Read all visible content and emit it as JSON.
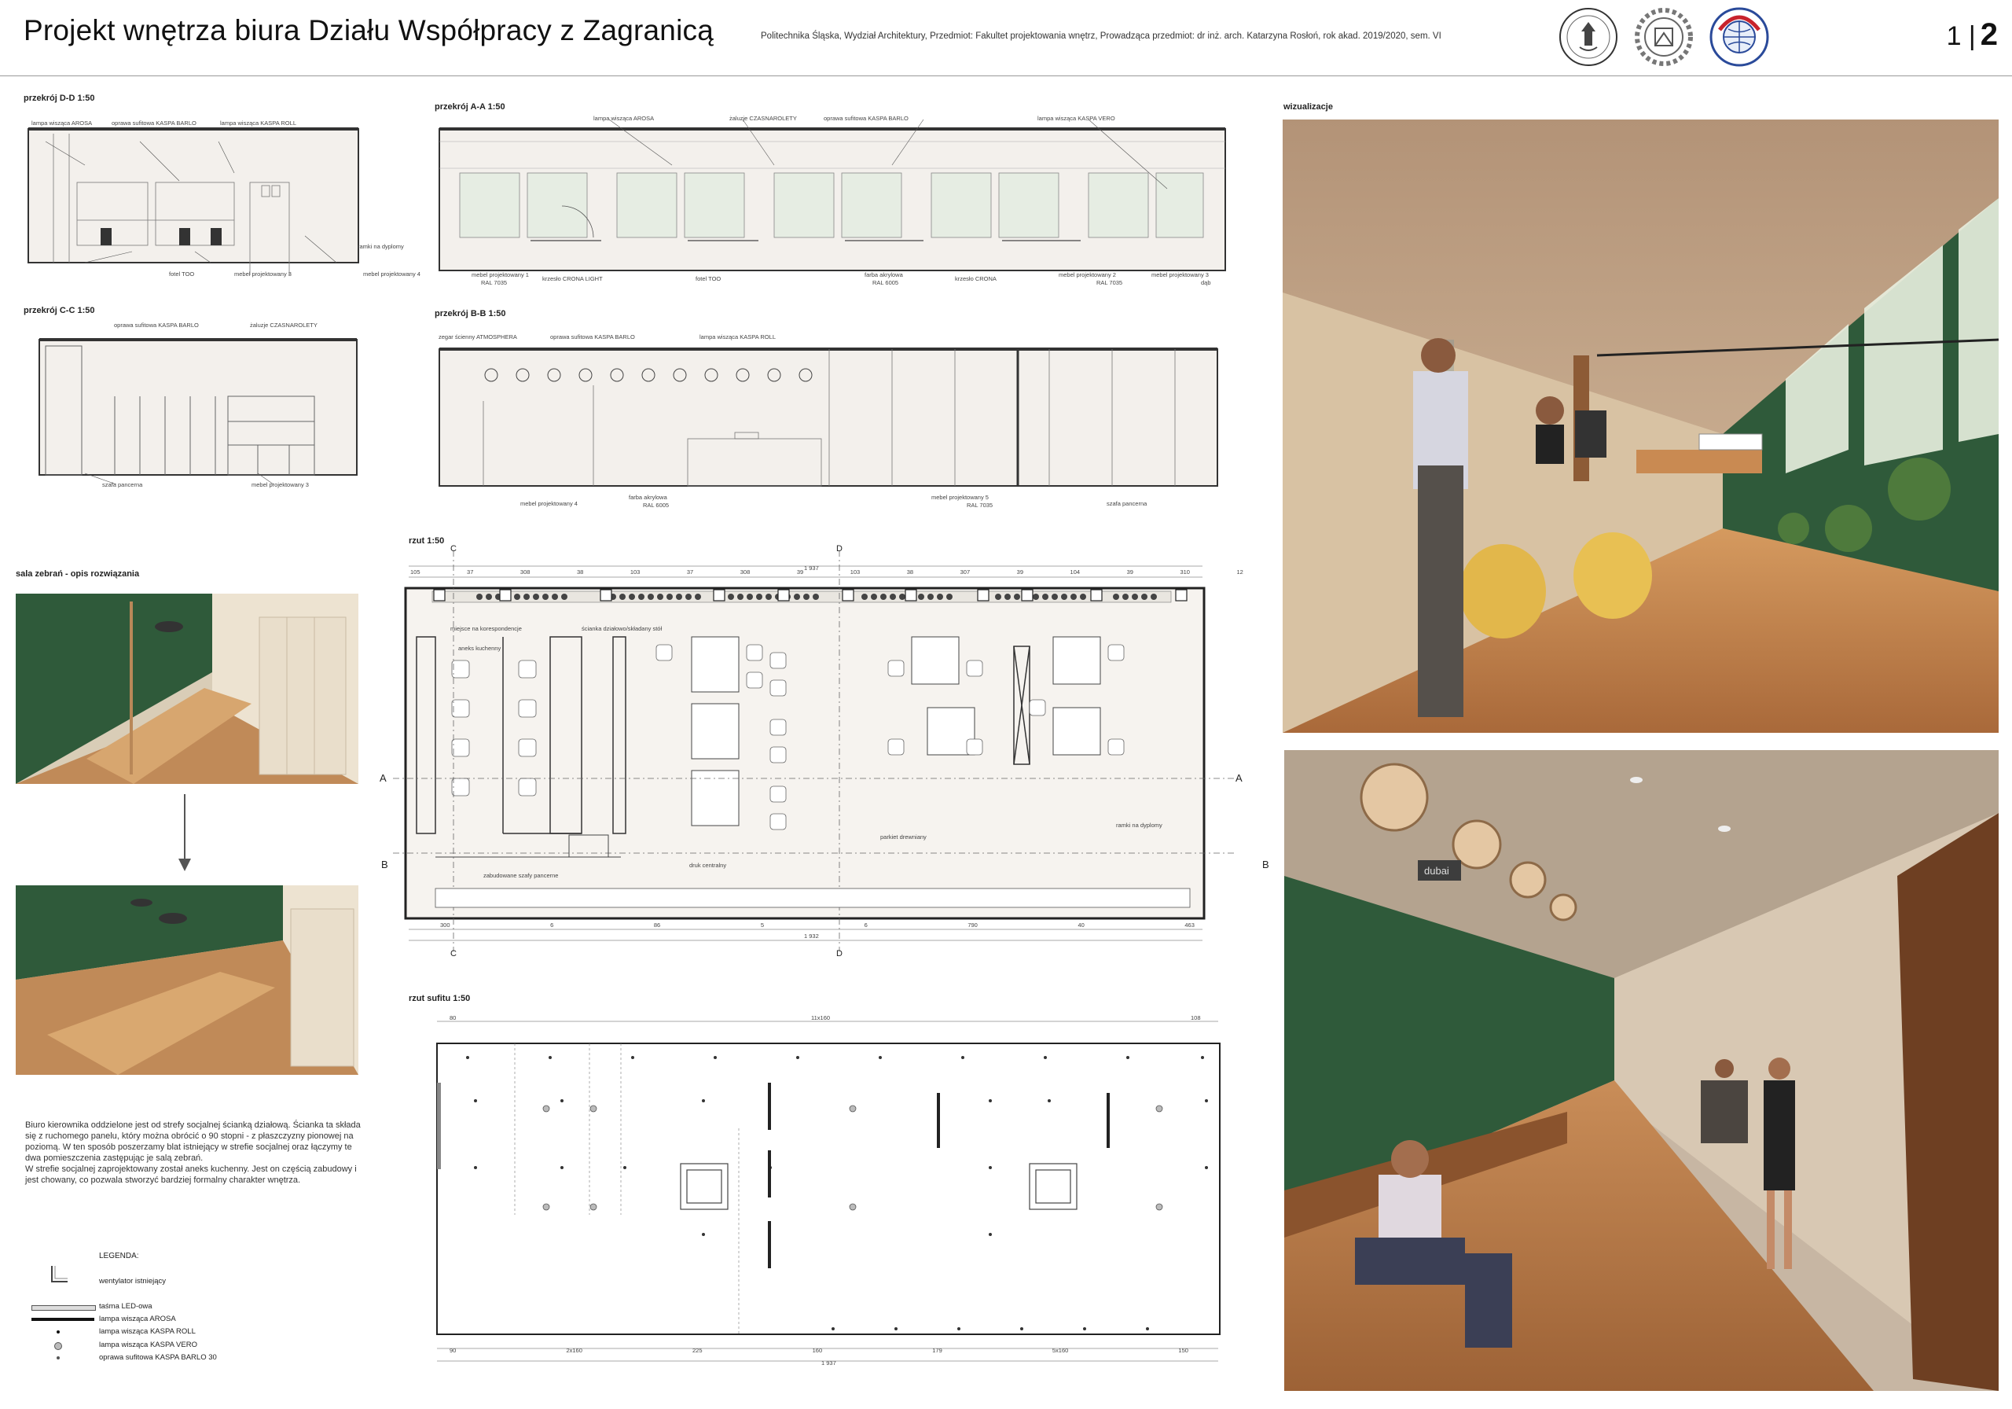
{
  "header": {
    "title": "Projekt wnętrza biura Działu Współpracy z Zagranicą",
    "info": "Politechnika Śląska, Wydział Architektury, Przedmiot: Fakultet projektowania wnętrz, Prowadząca przedmiot: dr inż. arch. Katarzyna Rosłoń, rok akad. 2019/2020, sem. VI",
    "page_prefix": "1 |",
    "page_number": "2",
    "logo3_text": "INTERNATIONAL MOBILITY OFFICE SILESIAN UNIVERSITY OF TECHNOLOGY"
  },
  "sections": {
    "dd": "przekrój D-D 1:50",
    "cc": "przekrój C-C 1:50",
    "aa": "przekrój A-A 1:50",
    "bb": "przekrój B-B 1:50",
    "rzut": "rzut 1:50",
    "sufit": "rzut sufitu 1:50",
    "sala": "sala zebrań - opis rozwiązania",
    "wiz": "wizualizacje"
  },
  "dd_labels": {
    "t1": "lampa wisząca AROSA",
    "t2": "oprawa sufitowa KASPA BARLO",
    "t3": "lampa wisząca KASPA ROLL",
    "r1": "ramki na dyplomy",
    "b1": "fotel TOO",
    "b2": "mebel projektowany 3",
    "b3": "mebel projektowany 4"
  },
  "cc_labels": {
    "t1": "oprawa sufitowa KASPA BARLO",
    "t2": "żaluzje CZASNAROLETY",
    "b1": "szafa pancerna",
    "b2": "mebel projektowany 3"
  },
  "aa_labels": {
    "t1": "lampa wisząca AROSA",
    "t2": "żaluzje CZASNAROLETY",
    "t3": "oprawa sufitowa KASPA BARLO",
    "t4": "lampa wisząca KASPA VERO",
    "b1": "mebel projektowany 1",
    "b1b": "RAL 7035",
    "b2": "krzesło CRONA LIGHT",
    "b3": "fotel TOO",
    "b4": "farba akrylowa",
    "b4b": "RAL 6005",
    "b5": "krzesło CRONA",
    "b6": "mebel projektowany 2",
    "b6b": "RAL 7035",
    "b7": "mebel projektowany 3",
    "b7b": "dąb"
  },
  "bb_labels": {
    "t1": "zegar ścienny ATMOSPHERA",
    "t2": "oprawa sufitowa KASPA BARLO",
    "t3": "lampa wisząca KASPA ROLL",
    "b1": "mebel projektowany 4",
    "b2": "farba akrylowa",
    "b2b": "RAL 6005",
    "b3": "mebel projektowany 5",
    "b3b": "RAL 7035",
    "b4": "szafa pancerna"
  },
  "plan_labels": {
    "total": "1 937",
    "total_bottom": "1 932",
    "p1": "miejsce na korespondencje",
    "p2": "ścianka działowo/składany stół",
    "p3": "aneks kuchenny",
    "p4": "parkiet drewniany",
    "p5": "ramki na dyplomy",
    "p6": "zabudowane szafy pancerne",
    "p7": "druk centralny",
    "top_dims": [
      "105",
      "37",
      "308",
      "38",
      "103",
      "37",
      "308",
      "39",
      "103",
      "38",
      "307",
      "39",
      "104",
      "39",
      "310",
      "12"
    ],
    "bottom_dims": [
      "300",
      "6",
      "86",
      "5",
      "6",
      "790",
      "40",
      "463"
    ],
    "a": "A",
    "b": "B",
    "c": "C",
    "d": "D"
  },
  "ceiling_labels": {
    "top_left": "80",
    "top_mid": "11x160",
    "top_right": "108",
    "bottom_dims": [
      "90",
      "2x160",
      "225",
      "160",
      "179",
      "5x160",
      "150"
    ],
    "total": "1 937"
  },
  "description": "Biuro kierownika oddzielone jest od strefy socjalnej ścianką działową. Ścianka ta składa się z ruchomego panelu, który można obrócić o 90 stopni - z płaszczyzny pionowej na poziomą. W ten sposób poszerzamy blat istniejący w strefie socjalnej oraz łączymy te dwa pomieszczenia zastępując je salą zebrań.\nW strefie socjalnej zaprojektowany został aneks kuchenny. Jest on częścią zabudowy i jest chowany, co pozwala stworzyć bardziej formalny charakter wnętrza.",
  "legend": {
    "title": "LEGENDA:",
    "items": [
      "wentylator istniejący",
      "taśma LED-owa",
      "lampa wisząca AROSA",
      "lampa wisząca KASPA ROLL",
      "lampa wisząca KASPA VERO",
      "oprawa sufitowa KASPA BARLO 30"
    ]
  },
  "viz": {
    "sign": "dubai"
  },
  "colors": {
    "green_wall": "#2f5a3a",
    "wood": "#c58a55",
    "panel_bg": "#f3f0ec"
  }
}
